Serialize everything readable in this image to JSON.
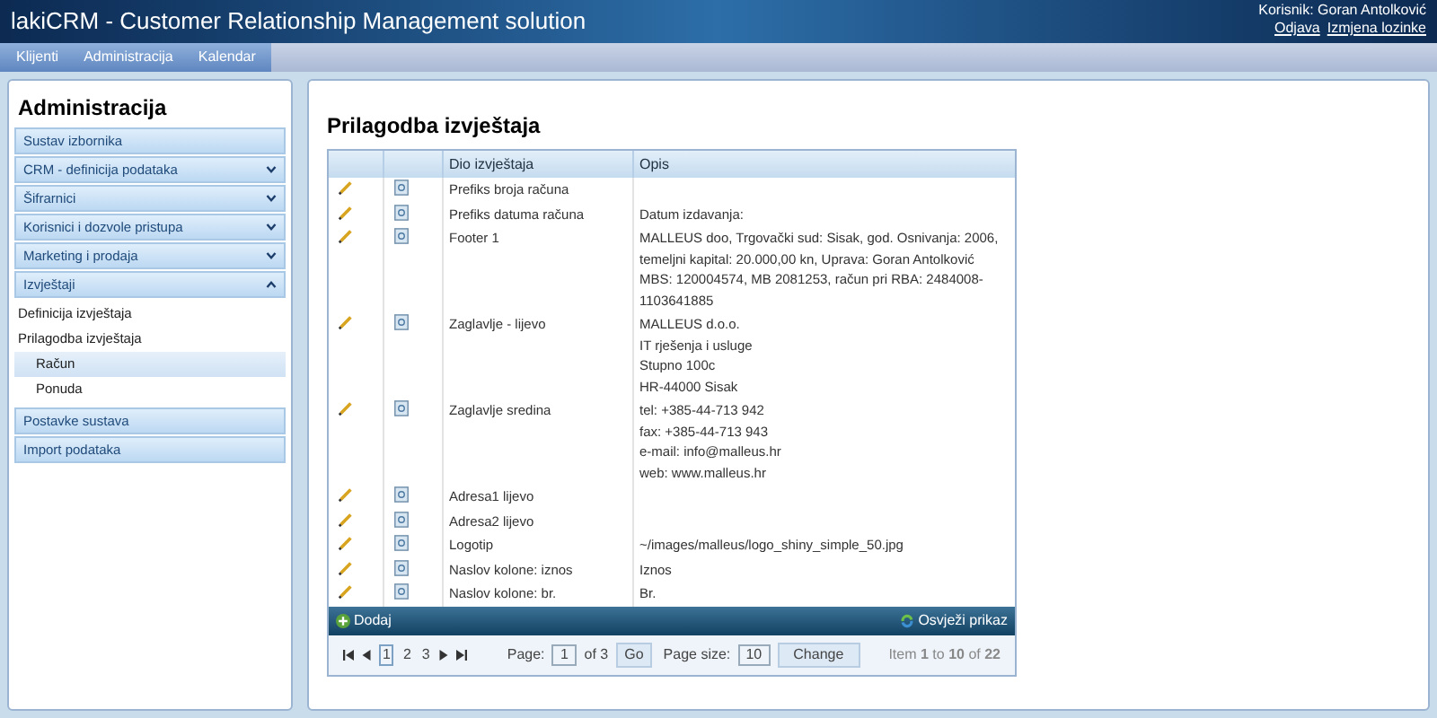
{
  "header": {
    "title": "lakiCRM - Customer Relationship Management solution",
    "user": "Korisnik: Goran Antolković",
    "links": [
      "Odjava",
      "Izmjena lozinke"
    ]
  },
  "menu": [
    {
      "label": "Klijenti"
    },
    {
      "label": "Administracija"
    },
    {
      "label": "Kalendar"
    }
  ],
  "sidebar": {
    "title": "Administracija",
    "items": [
      {
        "label": "Sustav izbornika"
      },
      {
        "label": "CRM - definicija podataka",
        "expanded": false
      },
      {
        "label": "Šifrarnici",
        "expanded": false
      },
      {
        "label": "Korisnici i dozvole pristupa",
        "expanded": false
      },
      {
        "label": "Marketing i prodaja",
        "expanded": false
      },
      {
        "label": "Izvještaji",
        "expanded": true,
        "children": [
          {
            "label": "Definicija izvještaja",
            "selected": false
          },
          {
            "label": "Prilagodba izvještaja",
            "selected": false,
            "children": [
              {
                "label": "Račun",
                "selected": true
              },
              {
                "label": "Ponuda",
                "selected": false
              }
            ]
          }
        ]
      },
      {
        "label": "Postavke sustava"
      },
      {
        "label": "Import podataka"
      }
    ]
  },
  "page_title": "Prilagodba izvještaja",
  "table": {
    "columns": [
      "Dio izvještaja",
      "Opis"
    ],
    "rows": [
      {
        "part": "Prefiks broja računa",
        "description": []
      },
      {
        "part": "Prefiks datuma računa",
        "description": [
          "Datum izdavanja:"
        ]
      },
      {
        "part": "Footer 1",
        "description": [
          "MALLEUS doo, Trgovački sud: Sisak, god. Osnivanja: 2006, temeljni kapital: 20.000,00 kn, Uprava: Goran Antolković",
          "MBS: 120004574, MB 2081253, račun pri RBA: 2484008-1103641885"
        ]
      },
      {
        "part": "Zaglavlje - lijevo",
        "description": [
          "MALLEUS d.o.o.",
          "IT rješenja i usluge",
          "Stupno 100c",
          "HR-44000 Sisak"
        ]
      },
      {
        "part": "Zaglavlje sredina",
        "description": [
          "tel: +385-44-713 942",
          "fax: +385-44-713 943",
          "e-mail: info@malleus.hr",
          "web: www.malleus.hr"
        ]
      },
      {
        "part": "Adresa1 lijevo",
        "description": []
      },
      {
        "part": "Adresa2 lijevo",
        "description": []
      },
      {
        "part": "Logotip",
        "description": [
          "~/images/malleus/logo_shiny_simple_50.jpg"
        ]
      },
      {
        "part": "Naslov kolone: iznos",
        "description": [
          "Iznos"
        ]
      },
      {
        "part": "Naslov kolone: br.",
        "description": [
          "Br."
        ]
      }
    ],
    "add_button": "Dodaj",
    "refresh_button": "Osvježi prikaz"
  },
  "pager": {
    "pages": [
      {
        "label": "1",
        "selected": true
      },
      {
        "label": "2",
        "selected": false
      },
      {
        "label": "3",
        "selected": false
      }
    ],
    "page_label": "Page:",
    "page_value": "1",
    "of_label": "of 3",
    "go": "Go",
    "size_label": "Page size:",
    "size_value": "10",
    "change": "Change",
    "summary": "Item **1** to **10** of **22**"
  }
}
